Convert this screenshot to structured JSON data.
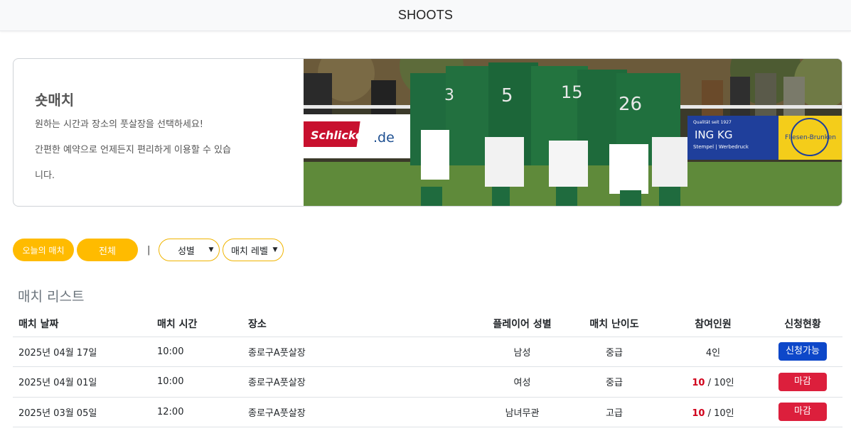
{
  "header": {
    "brand": "SHOOTS"
  },
  "hero": {
    "title": "숏매치",
    "line1": "원하는 시간과 장소의 풋살장을 선택하세요!",
    "line2": "간편한 예약으로 언제든지 편리하게 이용할 수 있습",
    "line3": "니다.",
    "image_text": {
      "sponsor1": "Schlickel",
      "sponsor1_suffix": ".de",
      "sponsor2": "ING KG",
      "sponsor2_small": "Qualität seit 1927",
      "sponsor2_sub": "Stempel | Werbedruck",
      "sponsor3": "Fliesen-Brunken"
    }
  },
  "filters": {
    "today_label": "오늘의 매치",
    "all_label": "전체",
    "separator": "|",
    "gender_select": "성별",
    "level_select": "매치 레벨"
  },
  "list": {
    "title": "매치 리스트",
    "columns": [
      "매치 날짜",
      "매치 시간",
      "장소",
      "플레이어 성별",
      "매치 난이도",
      "참여인원",
      "신청현황"
    ],
    "rows": [
      {
        "date": "2025년 04월 17일",
        "time": "10:00",
        "venue": "종로구A풋살장",
        "gender": "남성",
        "level": "중급",
        "count": "4인",
        "count_current": "",
        "count_sep": "",
        "status": "신청가능"
      },
      {
        "date": "2025년 04월 01일",
        "time": "10:00",
        "venue": "종로구A풋살장",
        "gender": "여성",
        "level": "중급",
        "count": "10인",
        "count_current": "10",
        "count_sep": " / ",
        "status": "마감"
      },
      {
        "date": "2025년 03월 05일",
        "time": "12:00",
        "venue": "종로구A풋살장",
        "gender": "남녀무관",
        "level": "고급",
        "count": "10인",
        "count_current": "10",
        "count_sep": " / ",
        "status": "마감"
      }
    ]
  },
  "colors": {
    "accent": "#ffbb00",
    "open": "#0d47c9",
    "closed": "#dc1f3c",
    "mid_level": "#e0a800",
    "high_level": "#c8102e"
  }
}
